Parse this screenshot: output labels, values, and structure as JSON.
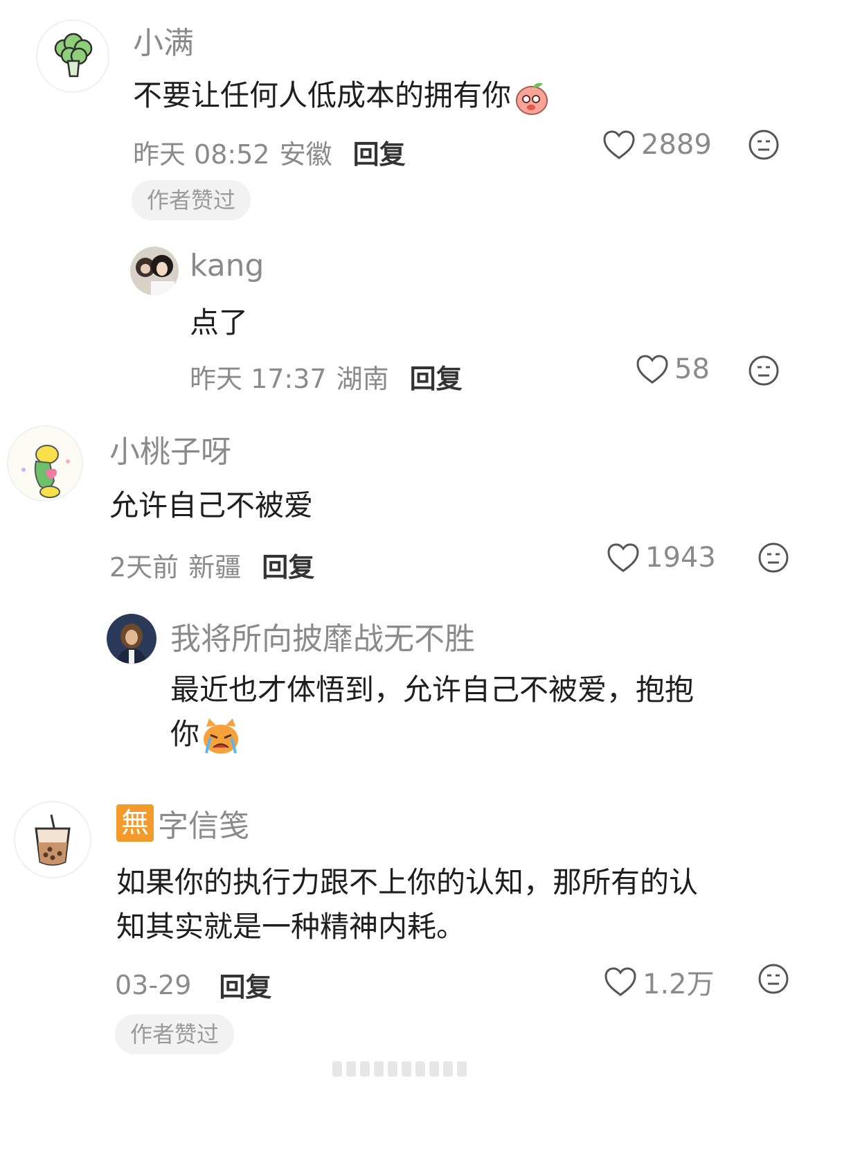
{
  "comments": [
    {
      "user": "小满",
      "text": "不要让任何人低成本的拥有你",
      "time": "昨天 08:52",
      "location": "安徽",
      "reply_label": "回复",
      "likes": "2889",
      "badge": "作者赞过",
      "avatar_icon": "broccoli-icon",
      "sticker_icon": "peach-emoji-icon",
      "replies": [
        {
          "user": "kang",
          "text": "点了",
          "time": "昨天 17:37",
          "location": "湖南",
          "reply_label": "回复",
          "likes": "58"
        }
      ]
    },
    {
      "user": "小桃子呀",
      "text": "允许自己不被爱",
      "time": "2天前",
      "location": "新疆",
      "reply_label": "回复",
      "likes": "1943",
      "avatar_icon": "cartoon-duck-icon",
      "replies": [
        {
          "user": "我将所向披靡战无不胜",
          "text_line1": "最近也才体悟到，允许自己不被爱，抱抱",
          "text_line2": "你",
          "sticker_icon": "crying-cat-emoji-icon"
        }
      ]
    },
    {
      "user_badge": "無",
      "user": "字信笺",
      "text_line1": "如果你的执行力跟不上你的认知，那所有的认",
      "text_line2": "知其实就是一种精神内耗。",
      "time": "03-29",
      "reply_label": "回复",
      "likes": "1.2万",
      "badge": "作者赞过",
      "avatar_icon": "bubble-tea-icon"
    }
  ],
  "colors": {
    "meta": "#8a8a8a",
    "text": "#1e1e1e",
    "badge_bg": "#f2f2f2",
    "wu_badge": "#f39a2a"
  }
}
